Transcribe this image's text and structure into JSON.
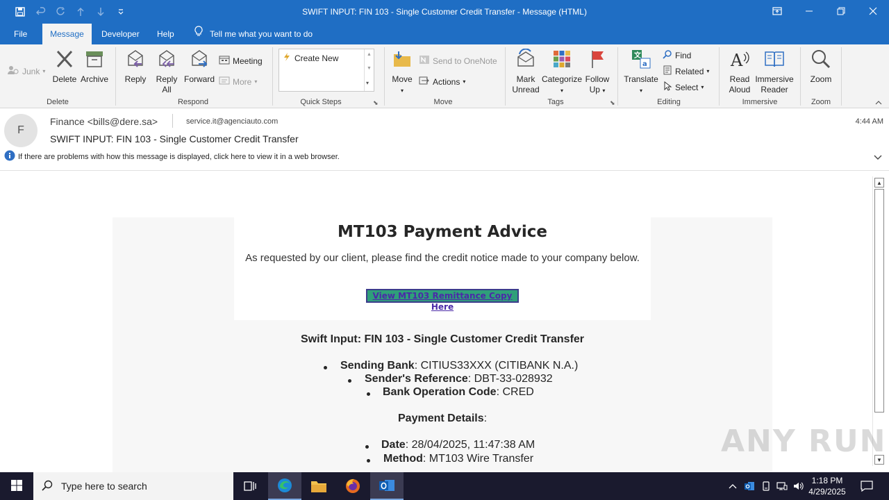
{
  "window": {
    "title": "SWIFT INPUT: FIN 103 - Single Customer Credit Transfer  -  Message (HTML)"
  },
  "ribbon_tabs": [
    "File",
    "Message",
    "Developer",
    "Help"
  ],
  "tell_me": "Tell me what you want to do",
  "ribbon": {
    "junk": "Junk",
    "delete": "Delete",
    "archive": "Archive",
    "reply": "Reply",
    "reply_all_1": "Reply",
    "reply_all_2": "All",
    "forward": "Forward",
    "meeting": "Meeting",
    "more": "More",
    "create_new": "Create New",
    "move": "Move",
    "send_onenote": "Send to OneNote",
    "actions": "Actions",
    "mark_unread_1": "Mark",
    "mark_unread_2": "Unread",
    "categorize": "Categorize",
    "follow_up_1": "Follow",
    "follow_up_2": "Up",
    "translate": "Translate",
    "find": "Find",
    "related": "Related",
    "select": "Select",
    "read_aloud_1": "Read",
    "read_aloud_2": "Aloud",
    "immersive_1": "Immersive",
    "immersive_2": "Reader",
    "zoom": "Zoom",
    "groups": {
      "delete": "Delete",
      "respond": "Respond",
      "quick_steps": "Quick Steps",
      "move": "Move",
      "tags": "Tags",
      "editing": "Editing",
      "immersive": "Immersive",
      "zoom": "Zoom"
    }
  },
  "message": {
    "avatar_initial": "F",
    "from": "Finance <bills@dere.sa>",
    "to": "service.it@agenciauto.com",
    "time": "4:44 AM",
    "subject": "SWIFT INPUT: FIN 103 - Single Customer Credit Transfer",
    "info": "If there are problems with how this message is displayed, click here to view it in a web browser."
  },
  "body": {
    "title": "MT103 Payment Advice",
    "intro": "As requested by our client, please find the credit notice made to your company below.",
    "link": "View MT103  Remittance Copy Here",
    "swift_title": "Swift Input: FIN 103 - Single Customer Credit Transfer",
    "sending_bank_label": "Sending Bank",
    "sending_bank_value": ": CITIUS33XXX (CITIBANK N.A.)",
    "sender_ref_label": "Sender's Reference",
    "sender_ref_value": ": DBT-33-028932",
    "bank_op_label": "Bank Operation Code",
    "bank_op_value": ": CRED",
    "payment_details_label": "Payment Details",
    "payment_details_colon": ":",
    "date_label": "Date",
    "date_value": ": 28/04/2025, 11:47:38 AM",
    "method_label": "Method",
    "method_value": ": MT103 Wire Transfer"
  },
  "watermark": "ANY RUN",
  "taskbar": {
    "search_placeholder": "Type here to search",
    "time": "1:18 PM",
    "date": "4/29/2025"
  }
}
